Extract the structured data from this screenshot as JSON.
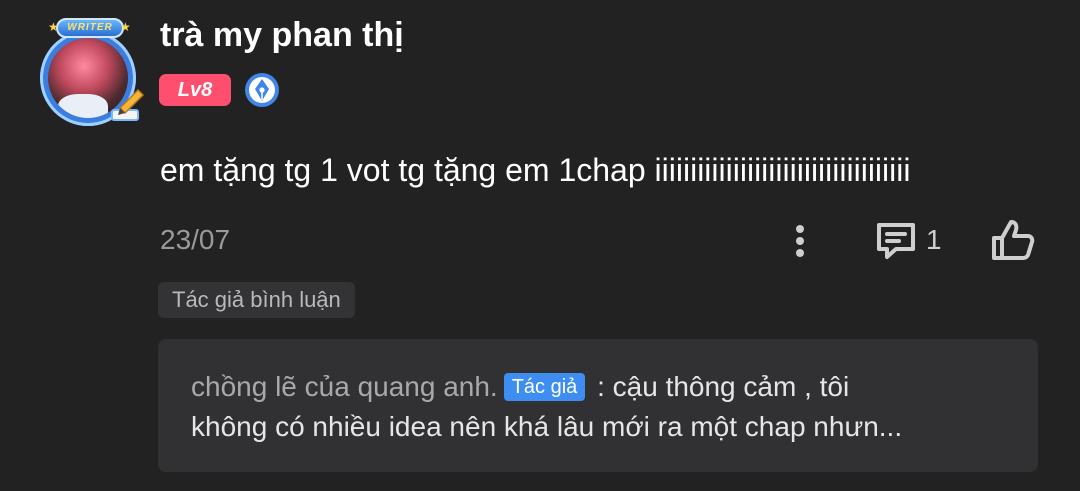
{
  "user": {
    "name": "trà my phan thị",
    "level": "Lv8",
    "avatar_ribbon": "WRITER"
  },
  "comment": {
    "text": "em tặng tg 1 vot tg tặng em 1chap iiiiiiiiiiiiiiiiiiiiiiiiiiiiiiiiiiii",
    "date": "23/07",
    "reply_count": "1",
    "author_tag": "Tác giả bình luận"
  },
  "reply": {
    "author": "chồng lẽ của quang anh.",
    "author_badge": "Tác giả",
    "separator": ":",
    "line1": "cậu thông cảm , tôi",
    "line2": "không có nhiều idea nên khá lâu mới ra một chap nhưn..."
  },
  "icons": {
    "more": "more-vertical-icon",
    "reply": "comment-icon",
    "like": "thumbs-up-icon",
    "writer_badge": "pen-nib-badge-icon"
  },
  "colors": {
    "background": "#222223",
    "level_badge": "#ff4f6e",
    "author_badge": "#3d8ef0",
    "reply_box": "#313133"
  }
}
